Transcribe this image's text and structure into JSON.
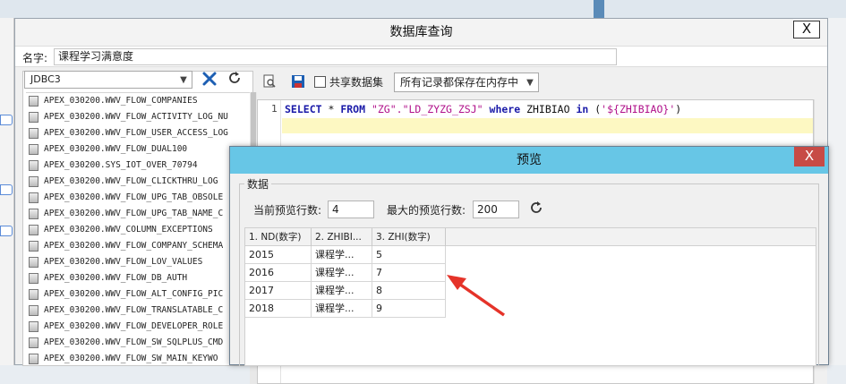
{
  "main_dialog": {
    "title": "数据库查询",
    "close_label": "X",
    "name_label": "名字:",
    "name_value": "课程学习满意度",
    "connection": "JDBC3",
    "share_label": "共享数据集",
    "memory_option": "所有记录都保存在内存中",
    "line_number": "1",
    "sql": {
      "select": "SELECT",
      "star": " * ",
      "from": "FROM",
      "table": " \"ZG\".\"LD_ZYZG_ZSJ\" ",
      "where": "where",
      "field": " ZHIBIAO ",
      "in": "in",
      "paren_open": " (",
      "param": "'${ZHIBIAO}'",
      "paren_close": ")"
    },
    "tables": [
      "APEX_030200.WWV_FLOW_COMPANIES",
      "APEX_030200.WWV_FLOW_ACTIVITY_LOG_NU",
      "APEX_030200.WWV_FLOW_USER_ACCESS_LOG",
      "APEX_030200.WWV_FLOW_DUAL100",
      "APEX_030200.SYS_IOT_OVER_70794",
      "APEX_030200.WWV_FLOW_CLICKTHRU_LOG",
      "APEX_030200.WWV_FLOW_UPG_TAB_OBSOLE",
      "APEX_030200.WWV_FLOW_UPG_TAB_NAME_C",
      "APEX_030200.WWV_COLUMN_EXCEPTIONS",
      "APEX_030200.WWV_FLOW_COMPANY_SCHEMA",
      "APEX_030200.WWV_FLOW_LOV_VALUES",
      "APEX_030200.WWV_FLOW_DB_AUTH",
      "APEX_030200.WWV_FLOW_ALT_CONFIG_PIC",
      "APEX_030200.WWV_FLOW_TRANSLATABLE_C",
      "APEX_030200.WWV_FLOW_DEVELOPER_ROLE",
      "APEX_030200.WWV_FLOW_SW_SQLPLUS_CMD",
      "APEX_030200.WWV_FLOW_SW_MAIN_KEYWO"
    ]
  },
  "preview": {
    "title": "预览",
    "close_label": "X",
    "group_label": "数据",
    "current_rows_label": "当前预览行数:",
    "current_rows_value": "4",
    "max_rows_label": "最大的预览行数:",
    "max_rows_value": "200",
    "columns": [
      "1. ND(数字)",
      "2. ZHIBI...",
      "3. ZHI(数字)"
    ],
    "rows": [
      [
        "2015",
        "课程学...",
        "5"
      ],
      [
        "2016",
        "课程学...",
        "7"
      ],
      [
        "2017",
        "课程学...",
        "8"
      ],
      [
        "2018",
        "课程学...",
        "9"
      ]
    ]
  },
  "colors": {
    "preview_title_bar": "#67c6e6",
    "close_red": "#c74b46",
    "annotation_arrow": "#e53329",
    "sql_keyword": "#1a1aa8",
    "sql_string": "#b0108a"
  }
}
